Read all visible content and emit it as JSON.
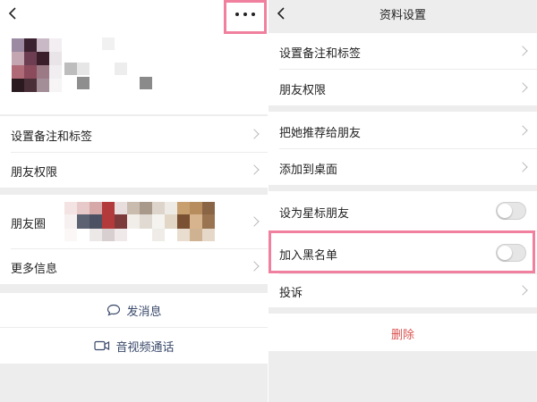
{
  "left": {
    "back_icon": "chevron-left-icon",
    "more_icon": "ellipsis-icon",
    "highlight_color": "#f0809e",
    "rows": [
      {
        "label": "设置备注和标签"
      },
      {
        "label": "朋友权限"
      },
      {
        "label": "朋友圈"
      },
      {
        "label": "更多信息"
      }
    ],
    "send_message": "发消息",
    "send_message_icon": "chat-bubble-icon",
    "av_call": "音视频通话",
    "av_call_icon": "video-camera-icon"
  },
  "right": {
    "title": "资料设置",
    "back_icon": "chevron-left-icon",
    "rows": [
      {
        "label": "设置备注和标签"
      },
      {
        "label": "朋友权限"
      },
      {
        "label": "把她推荐给朋友"
      },
      {
        "label": "添加到桌面"
      },
      {
        "label": "设为星标朋友",
        "toggle": "off"
      },
      {
        "label": "加入黑名单",
        "toggle": "off"
      },
      {
        "label": "投诉"
      }
    ],
    "delete_label": "删除",
    "delete_color": "#d9534f"
  }
}
